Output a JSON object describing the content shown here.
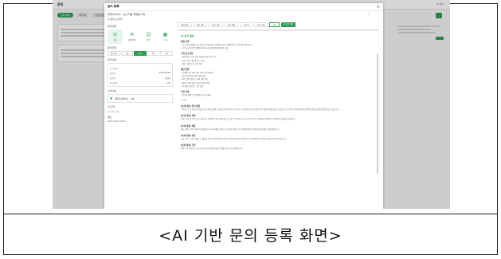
{
  "caption": "<AI 기반 문의 등록 화면>",
  "background": {
    "title": "문의",
    "right_text": "내 문의",
    "tabs": [
      "전체 문의",
      "처리 중",
      "답변 완료"
    ]
  },
  "modal": {
    "title": "문의 등록",
    "close_icon": "close-icon",
    "subtitle": "제주디자이너 · 신규 직원 플랫폼 구축",
    "toolbar": "AI 문의 도우미",
    "left": {
      "section_channel": "문의 채널",
      "actions": [
        {
          "icon": "phone-icon",
          "glyph": "☏",
          "label": "전화"
        },
        {
          "icon": "chat-icon",
          "glyph": "✉",
          "label": "메일/채팅"
        },
        {
          "icon": "person-icon",
          "glyph": "☺",
          "label": "방문"
        },
        {
          "icon": "grid-icon",
          "glyph": "▦",
          "label": "기타"
        }
      ],
      "section_type": "문의 유형",
      "categories": [
        "일반문의",
        "기술",
        "견적",
        "계약",
        "기타"
      ],
      "section_status": "문의 상태",
      "status_label": "진행 현황",
      "kv": [
        {
          "k": "접수일",
          "v": "2024.06.01"
        },
        {
          "k": "담당자",
          "v": "김담당"
        },
        {
          "k": "우선순위",
          "v": "보통"
        }
      ],
      "section_customer": "고객 정보",
      "gem_label": "제주디자이너",
      "gem_count": "VIP",
      "section_ai": "AI 요약",
      "section_ai_note": "요약 결과 확인",
      "memo_label": "메모",
      "memo_value": "2024.06.01 09:00"
    },
    "right": {
      "tabs": [
        "상세 내용",
        "관련 문의",
        "처리 이력",
        "첨부 파일",
        "AI 분석",
        "유사 사례"
      ],
      "btn_outline": "저장",
      "btn_primary": "AI 답변 생성",
      "content_head": "AI 분석 결과",
      "sub1": "핵심 요약",
      "sub1_lines": [
        "신규 직원 플랫폼 구축 관련 요구사항 정리 및 일정, 예산, 범위에 대한 고객 문의 내용 요약",
        "기존 시스템 연동 범위와 데이터 이관 방안에 대한 확인 요청"
      ],
      "sub2": "고객 요구사항",
      "sub2_lines": [
        "계정 관리: 신규 직원 등록 및 권한 관리 기능",
        "보안: 접근 제어 및 로그 관리",
        "일정: 하반기 내 오픈 목표"
      ],
      "sub3": "제안 방향",
      "sub3_lines": [
        "단계별 구축 방안 제시 및 우선순위 협의",
        "유사 사례 기반 예산 범위 안내",
        "연동 범위 확정 후 상세 견적 제공",
        "데이터 이관 절차 및 검증 계획 안내",
        "운영 및 유지보수 조건 안내"
      ],
      "sub4": "다음 단계",
      "sub4_lines": [
        "담당자 배정 후 1영업일 내 회신 예정"
      ],
      "para_note": "AI 생성",
      "paragraphs": [
        {
          "head": "[상세 내용] 문의 배경",
          "text": "고객사는 신규 직원 온보딩을 위한 통합 플랫폼 구축을 검토 중이며, 기존 인사 시스템과의 연동 및 권한 관리 체계 정비를 원하고 있습니다. 요구사항 정의 단계에서 범위와 일정을 함께 협의할 필요가 있습니다."
        },
        {
          "head": "[상세 내용] 일정",
          "text": "하반기 오픈을 목표로 하고 있으며, 단계별 구축을 통해 핵심 기능을 우선 제공하고 부가 기능은 이후 단계에서 순차적으로 반영하는 방안을 선호합니다."
        },
        {
          "head": "[상세 내용] 예산",
          "text": "예산 범위는 아직 확정되지 않았으며, 유사 사례를 기반으로 한 예상 비용과 구축 범위별 비용 차이에 대한 안내를 요청하였습니다."
        },
        {
          "head": "[상세 내용] 연동",
          "text": "기존 인사 시스템, 메일 시스템과의 연동 여부와 데이터 이관 방식에 대해 확인이 필요하며, 보안 정책 준수 여부도 함께 검토되어야 합니다."
        },
        {
          "head": "[상세 내용] 기타",
          "text": "운영 이후 유지보수 조건과 교육 지원 범위에 대한 안내를 추가로 요청하였습니다."
        }
      ]
    }
  }
}
